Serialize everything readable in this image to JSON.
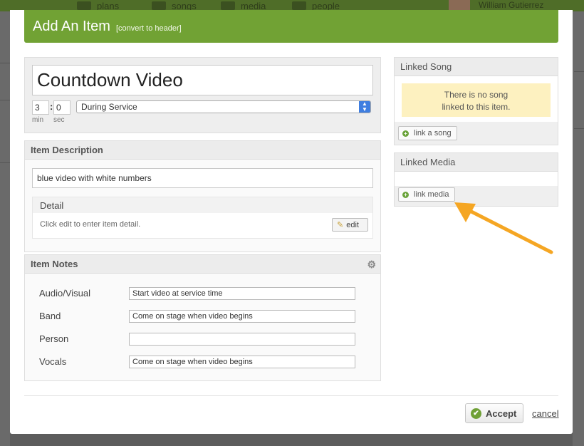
{
  "background": {
    "nav": [
      {
        "label": "plans",
        "icon": "plans-icon"
      },
      {
        "label": "songs",
        "icon": "songs-icon"
      },
      {
        "label": "media",
        "icon": "media-icon"
      },
      {
        "label": "people",
        "icon": "people-icon"
      }
    ],
    "user_name": "William Gutierrez"
  },
  "modal": {
    "title": "Add An Item",
    "convert_link": "[convert to header]",
    "item_title": "Countdown Video",
    "length_min": "3",
    "length_sec": "0",
    "min_label": "min",
    "sec_label": "sec",
    "service_position": "During Service"
  },
  "description": {
    "heading": "Item Description",
    "value": "blue video with white numbers",
    "detail_heading": "Detail",
    "detail_hint": "Click edit to enter item detail.",
    "edit_label": "edit"
  },
  "notes": {
    "heading": "Item Notes",
    "rows": [
      {
        "label": "Audio/Visual",
        "value": "Start video at service time"
      },
      {
        "label": "Band",
        "value": "Come on stage when video begins"
      },
      {
        "label": "Person",
        "value": ""
      },
      {
        "label": "Vocals",
        "value": "Come on stage when video begins"
      }
    ]
  },
  "linked_song": {
    "heading": "Linked Song",
    "empty_line1": "There is no song",
    "empty_line2": "linked to this item.",
    "button": "link a song"
  },
  "linked_media": {
    "heading": "Linked Media",
    "button": "link media"
  },
  "footer": {
    "accept": "Accept",
    "cancel": "cancel"
  },
  "colors": {
    "header_green": "#71a234",
    "arrow_orange": "#f5a623",
    "note_yellow": "#fdf1c0"
  }
}
